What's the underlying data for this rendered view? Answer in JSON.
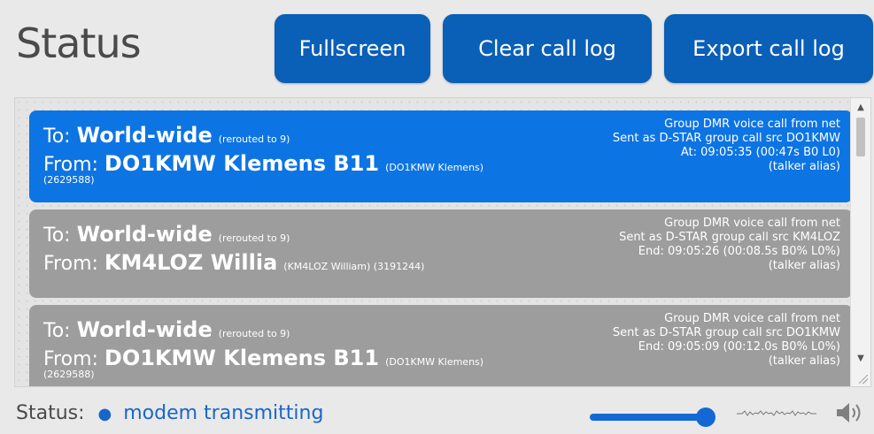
{
  "header": {
    "title": "Status",
    "buttons": {
      "fullscreen": "Fullscreen",
      "clear_log": "Clear call log",
      "export_log": "Export call log"
    }
  },
  "calls": [
    {
      "to_label": "To:",
      "to_target": "World-wide",
      "to_note": "(rerouted to 9)",
      "from_label": "From:",
      "from_name": "DO1KMW Klemens B11",
      "from_note": "(DO1KMW Klemens)",
      "id_line": "(2629588)",
      "info1": "Group DMR voice call from net",
      "info2": "Sent as D-STAR group call src DO1KMW",
      "info3": "At: 09:05:35 (00:47s B0 L0)",
      "info4": "(talker alias)"
    },
    {
      "to_label": "To:",
      "to_target": "World-wide",
      "to_note": "(rerouted to 9)",
      "from_label": "From:",
      "from_name": "KM4LOZ Willia",
      "from_note": "(KM4LOZ William) (3191244)",
      "id_line": "",
      "info1": "Group DMR voice call from net",
      "info2": "Sent as D-STAR group call src KM4LOZ",
      "info3": "End: 09:05:26 (00:08.5s B0% L0%)",
      "info4": "(talker alias)"
    },
    {
      "to_label": "To:",
      "to_target": "World-wide",
      "to_note": "(rerouted to 9)",
      "from_label": "From:",
      "from_name": "DO1KMW Klemens B11",
      "from_note": "(DO1KMW Klemens)",
      "id_line": "(2629588)",
      "info1": "Group DMR voice call from net",
      "info2": "Sent as D-STAR group call src DO1KMW",
      "info3": "End: 09:05:09 (00:12.0s B0% L0%)",
      "info4": "(talker alias)"
    }
  ],
  "status": {
    "label": "Status:",
    "value": "modem transmitting"
  },
  "audio": {
    "volume_fraction": 0.92
  },
  "colors": {
    "accent": "#0a5fb7",
    "active_call": "#0d74e4",
    "idle_call": "#9d9d9d",
    "status_text": "#1a66c8"
  },
  "icons": {
    "scroll_up": "triangle-up",
    "scroll_down": "triangle-down",
    "waveform": "waveform",
    "speaker": "speaker"
  }
}
